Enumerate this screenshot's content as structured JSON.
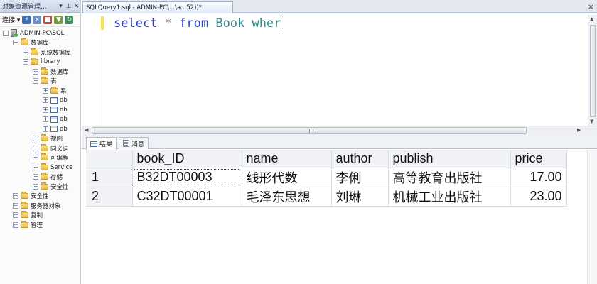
{
  "explorer": {
    "title": "对象资源管理...",
    "header_icons": [
      "pin-dropdown-icon",
      "pin-icon",
      "close-icon"
    ],
    "connect_label": "连接",
    "tree": [
      {
        "label": "ADMIN-PC\\SQL",
        "type": "server",
        "toggle": "⊟",
        "indent": 0
      },
      {
        "label": "数据库",
        "type": "folder",
        "toggle": "⊟",
        "indent": 1
      },
      {
        "label": "系统数据库",
        "type": "folder",
        "toggle": "⊞",
        "indent": 2
      },
      {
        "label": "library",
        "type": "folder",
        "toggle": "⊟",
        "indent": 2
      },
      {
        "label": "数据库",
        "type": "folder",
        "toggle": "⊞",
        "indent": 3
      },
      {
        "label": "表",
        "type": "folder",
        "toggle": "⊟",
        "indent": 3
      },
      {
        "label": "系",
        "type": "folder",
        "toggle": "⊞",
        "indent": 4
      },
      {
        "label": "db",
        "type": "table",
        "toggle": "⊞",
        "indent": 4
      },
      {
        "label": "db",
        "type": "table",
        "toggle": "⊞",
        "indent": 4
      },
      {
        "label": "db",
        "type": "table",
        "toggle": "⊞",
        "indent": 4
      },
      {
        "label": "db",
        "type": "table",
        "toggle": "⊞",
        "indent": 4
      },
      {
        "label": "视图",
        "type": "folder",
        "toggle": "⊞",
        "indent": 3
      },
      {
        "label": "同义词",
        "type": "folder",
        "toggle": "⊞",
        "indent": 3
      },
      {
        "label": "可编程",
        "type": "folder",
        "toggle": "⊞",
        "indent": 3
      },
      {
        "label": "Service",
        "type": "folder",
        "toggle": "⊞",
        "indent": 3
      },
      {
        "label": "存储",
        "type": "folder",
        "toggle": "⊞",
        "indent": 3
      },
      {
        "label": "安全性",
        "type": "folder",
        "toggle": "⊞",
        "indent": 3
      },
      {
        "label": "安全性",
        "type": "folder",
        "toggle": "⊞",
        "indent": 1
      },
      {
        "label": "服务器对象",
        "type": "folder",
        "toggle": "⊞",
        "indent": 1
      },
      {
        "label": "复制",
        "type": "folder",
        "toggle": "⊞",
        "indent": 1
      },
      {
        "label": "管理",
        "type": "folder",
        "toggle": "⊞",
        "indent": 1
      }
    ]
  },
  "document_tab": {
    "title": "SQLQuery1.sql - ADMIN-PC\\...\\a...52))*",
    "close_glyph": "×"
  },
  "editor": {
    "tokens": [
      {
        "text": "select",
        "kind": "kw"
      },
      {
        "text": " * ",
        "kind": "op"
      },
      {
        "text": "from",
        "kind": "kw"
      },
      {
        "text": " Book wher",
        "kind": "id"
      }
    ]
  },
  "result_tabs": {
    "results_label": "结果",
    "messages_label": "消息"
  },
  "results": {
    "columns": [
      "book_ID",
      "name",
      "author",
      "publish",
      "price"
    ],
    "rows": [
      {
        "num": "1",
        "cells": [
          "B32DT00003",
          "线形代数",
          "李俐",
          "高等教育出版社",
          "17.00"
        ]
      },
      {
        "num": "2",
        "cells": [
          "C32DT00001",
          "毛泽东思想",
          "刘琳",
          "机械工业出版社",
          "23.00"
        ]
      }
    ]
  }
}
